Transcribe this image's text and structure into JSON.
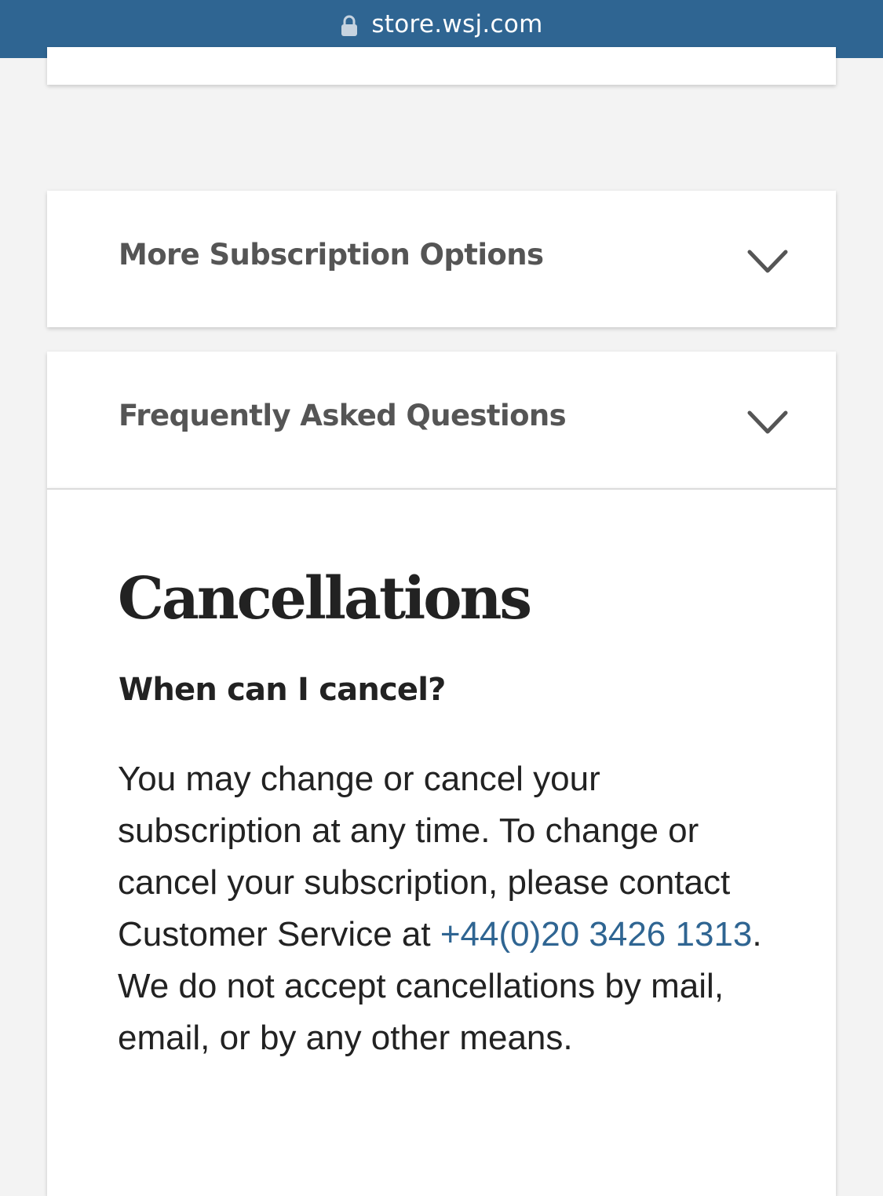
{
  "browser": {
    "url": "store.wsj.com",
    "lock_icon": "lock-icon",
    "bar_color": "#2f6592"
  },
  "accordions": [
    {
      "label": "More Subscription Options",
      "icon": "chevron-down-icon"
    },
    {
      "label": "Frequently Asked Questions",
      "icon": "chevron-down-icon"
    }
  ],
  "faq": {
    "section_title": "Cancellations",
    "question": "When can I cancel?",
    "answer_before": "You may change or cancel your subscription at any time. To change or cancel your subscription, please contact Customer Service at ",
    "phone": "+44(0)20 3426 1313",
    "answer_after": ". We do not accept cancellations by mail, email, or by any other means.",
    "link_color": "#2f6592"
  }
}
